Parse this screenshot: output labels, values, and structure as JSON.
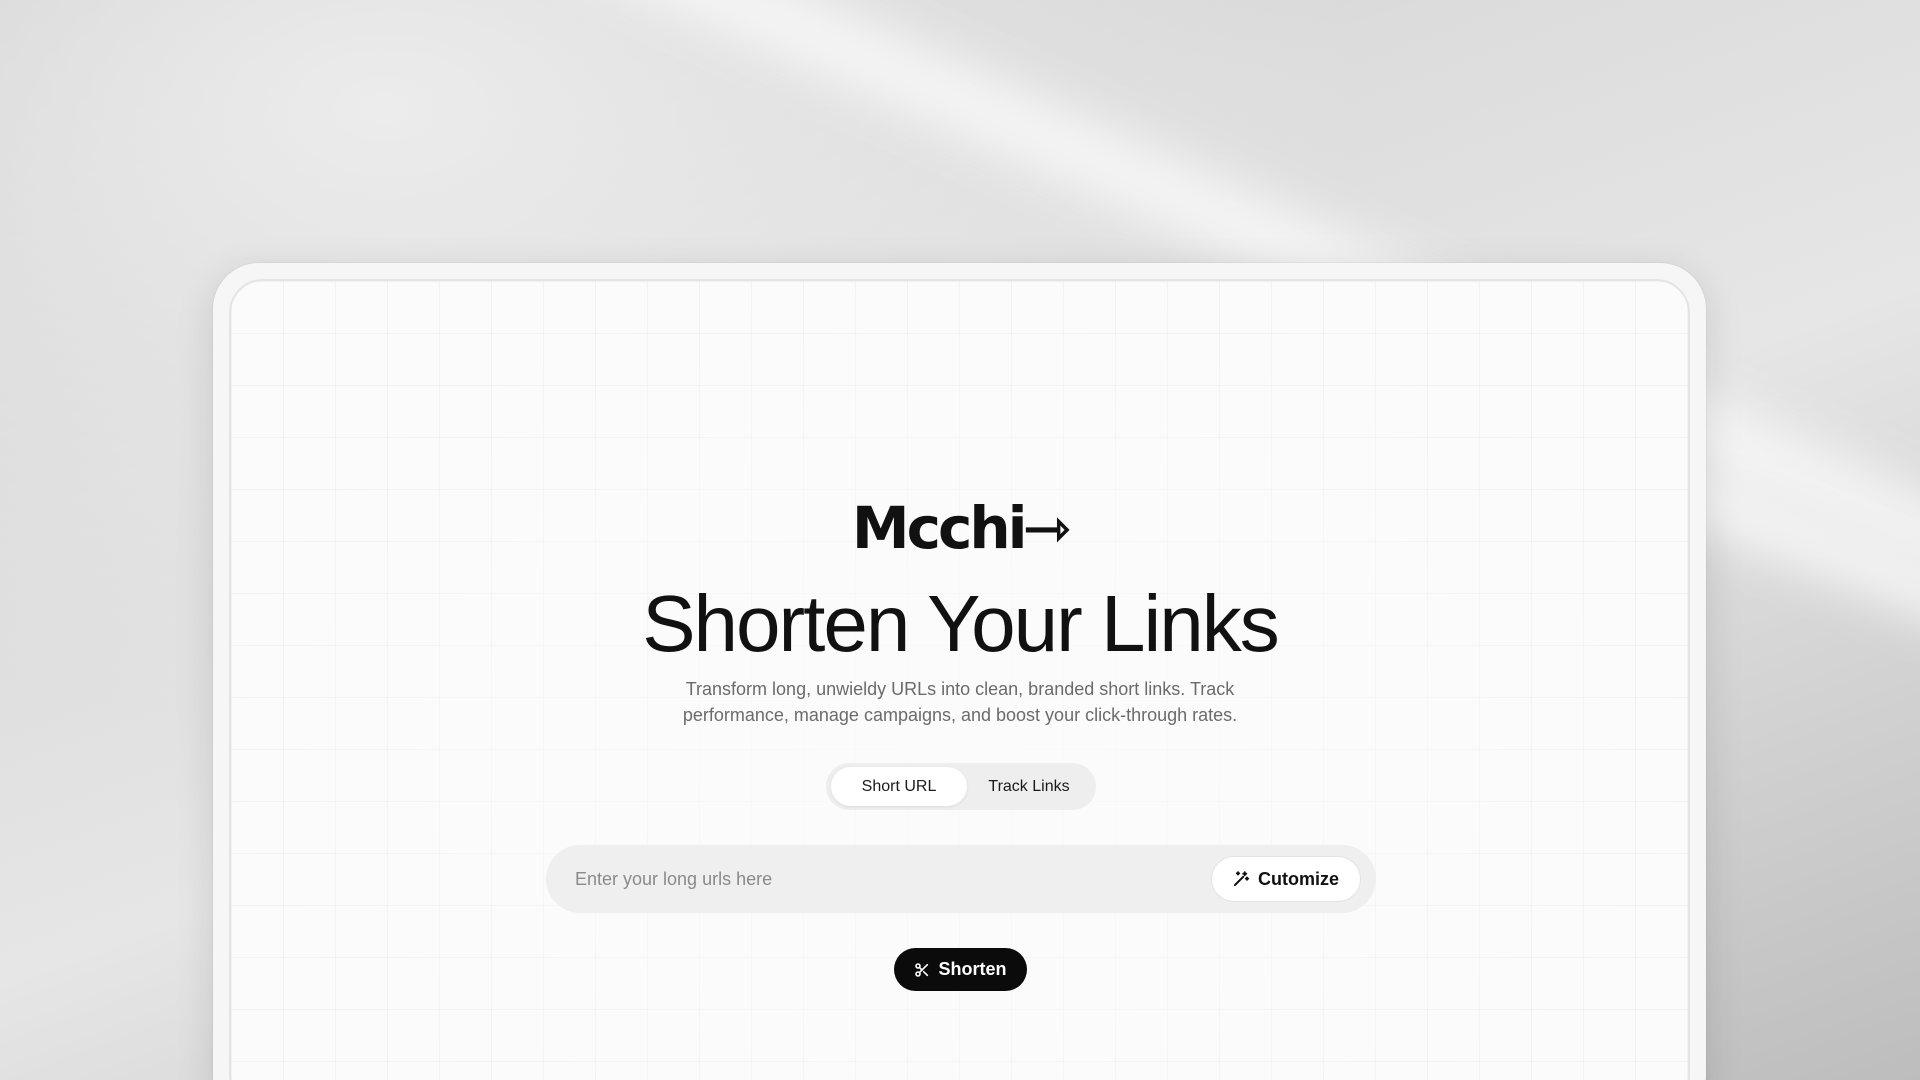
{
  "brand": {
    "logo_text": "Mcchi",
    "logo_arrow": "⇾"
  },
  "hero": {
    "title": "Shorten Your Links",
    "subtitle": "Transform long, unwieldy URLs into clean, branded short links. Track performance, manage campaigns, and boost your click-through rates."
  },
  "tabs": [
    {
      "label": "Short URL",
      "active": true
    },
    {
      "label": "Track Links",
      "active": false
    }
  ],
  "url_form": {
    "placeholder": "Enter your long urls here",
    "value": "",
    "customize_label": "Cutomize",
    "customize_icon": "magic-wand-icon"
  },
  "action": {
    "shorten_label": "Shorten",
    "shorten_icon": "scissors-icon"
  },
  "colors": {
    "primary_button": "#0b0b0b",
    "text_primary": "#111111",
    "text_muted": "#6b6b6b",
    "input_bg": "#efefef"
  }
}
